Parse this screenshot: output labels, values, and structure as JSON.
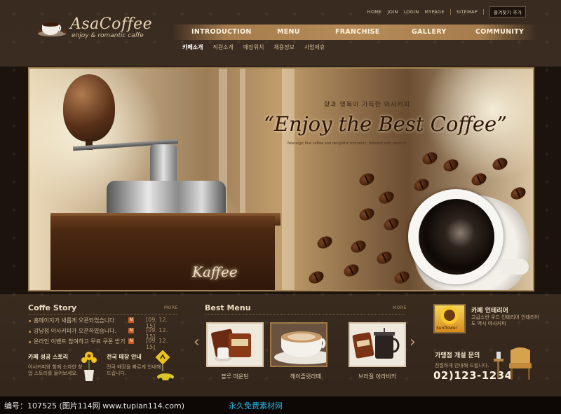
{
  "brand": {
    "name": "AsaCoffee",
    "tagline": "enjoy & romantic caffe"
  },
  "top_links": {
    "home": "HOME",
    "join": "JOIN",
    "login": "LOGIN",
    "mypage": "MYPAGE",
    "sitemap": "SITEMAP",
    "favorite_button": "즐겨찾기 추가"
  },
  "nav": {
    "items": [
      "INTRODUCTION",
      "MENU",
      "FRANCHISE",
      "GALLERY",
      "COMMUNITY"
    ]
  },
  "subnav": {
    "items": [
      "카페소개",
      "직원소개",
      "매장위치",
      "채용정보",
      "사업제휴"
    ],
    "active": 0
  },
  "hero": {
    "kicker": "향과 행복이 가득한 아사커피",
    "title": "“Enjoy the Best Coffee”",
    "small_text": "Nostalgic fine coffee and delightful moments, blended with warmth",
    "overlay_word": "Kaffee"
  },
  "coffee_story": {
    "title": "Coffe Story",
    "more": "MORE",
    "items": [
      {
        "text": "홈페이지가 새롭게 오픈되었습니다",
        "new_badge": "N",
        "date": "[09. 12. 15]"
      },
      {
        "text": "강남점 아사커피가 오픈하였습니다.",
        "new_badge": "N",
        "date": "[09. 12. 15]"
      },
      {
        "text": "온라인 이벤트 참여하고 무료 쿠폰 받기",
        "new_badge": "N",
        "date": "[09. 12. 15]"
      }
    ]
  },
  "success_story": {
    "title": "카페 성공 스토리",
    "desc": "아사커피와 함께 소자한 창업 스토리를 들어보세요."
  },
  "store_info": {
    "title": "전국 매장 안내",
    "desc": "전국 매장을 빠르게 안내해 드립니다."
  },
  "best_menu": {
    "title": "Best Menu",
    "more": "MORE",
    "items": [
      {
        "label": "블루 마운틴"
      },
      {
        "label": "헤이즐럿라떼"
      },
      {
        "label": "브라질 아라비카"
      }
    ],
    "prev_arrow": "‹",
    "next_arrow": "›"
  },
  "partner": {
    "title": "카페 인테리어",
    "desc": "고급스런 우드 인테리어 인테리어도 역시 아사커피",
    "image_caption": "Sunflower"
  },
  "franchise": {
    "title": "가맹점 개설 문의",
    "desc": "친절하게 안내해 드립니다.",
    "phone": "02)123-1234"
  },
  "footer": {
    "left": "编号：107525 (图片114网 www.tupian114.com)",
    "right": "永久免费素材网"
  },
  "icons": [
    "coffee-cup-icon",
    "chevron-left-icon",
    "chevron-right-icon",
    "sunflower-icon",
    "coffee-bean-icon",
    "chair-icon",
    "flower-vase-icon",
    "road-sign-icon",
    "car-icon"
  ],
  "colors": {
    "background": "#3a2b20",
    "accent": "#b68b59",
    "text": "#eddcc0",
    "badge": "#c85a1e",
    "watermark_link": "#28b5e6"
  }
}
